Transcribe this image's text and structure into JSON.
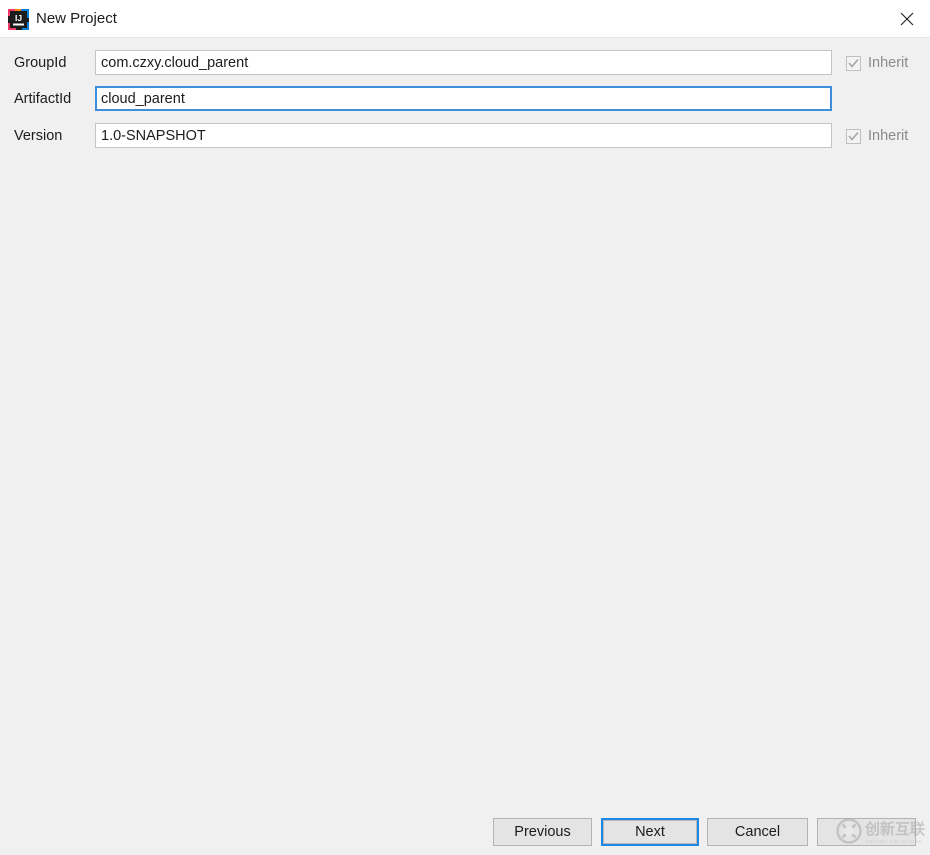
{
  "window": {
    "title": "New Project",
    "icon": "intellij-idea-icon",
    "close_icon": "close-icon"
  },
  "form": {
    "rows": [
      {
        "label": "GroupId",
        "value": "com.czxy.cloud_parent",
        "placeholder": "",
        "focused": false,
        "inherit": {
          "label": "Inherit",
          "checked": true,
          "disabled": true
        }
      },
      {
        "label": "ArtifactId",
        "value": "cloud_parent",
        "placeholder": "",
        "focused": true,
        "inherit": null
      },
      {
        "label": "Version",
        "value": "1.0-SNAPSHOT",
        "placeholder": "",
        "focused": false,
        "inherit": {
          "label": "Inherit",
          "checked": true,
          "disabled": true
        }
      }
    ]
  },
  "buttons": {
    "previous": "Previous",
    "next": "Next",
    "cancel": "Cancel",
    "help": ""
  },
  "watermark": {
    "cn_text": "创新互联",
    "en_text": "CHUANG XIN HU LIAN",
    "logo": "circle-x-logo"
  },
  "colors": {
    "background": "#f0f0f0",
    "titlebar": "#ffffff",
    "field_border": "#c4c4c4",
    "focus_blue": "#3d8fdd",
    "button_focus_blue": "#1e88e5",
    "button_face": "#e4e4e4",
    "text": "#1c1c1c",
    "disabled_text": "#8a8a8a"
  }
}
